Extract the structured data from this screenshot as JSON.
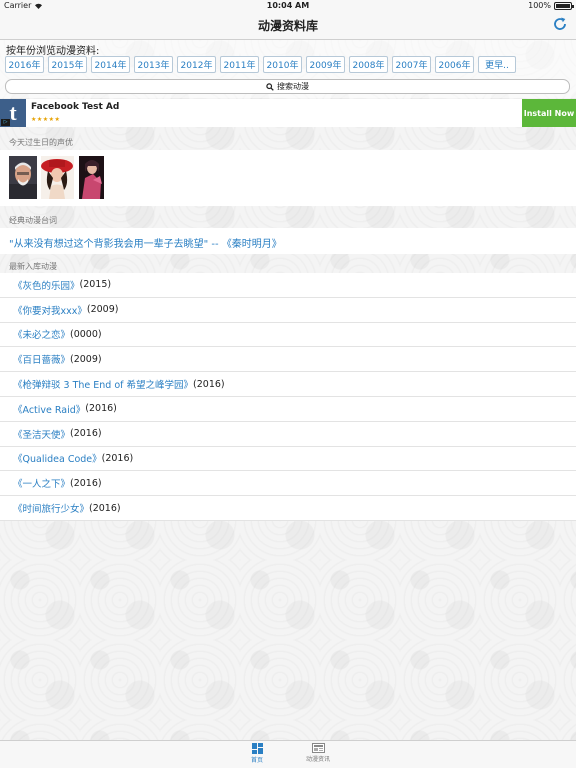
{
  "status_bar": {
    "carrier": "Carrier",
    "time": "10:04 AM",
    "battery": "100%",
    "battery_level": 1.0
  },
  "nav": {
    "title": "动漫资料库",
    "refresh_icon": "refresh-icon"
  },
  "year_browse": {
    "label": "按年份浏览动漫资料:",
    "years": [
      "2016年",
      "2015年",
      "2014年",
      "2013年",
      "2012年",
      "2011年",
      "2010年",
      "2009年",
      "2008年",
      "2007年",
      "2006年"
    ],
    "more": "更早..",
    "search_label": "搜索动漫",
    "search_icon": "search-icon"
  },
  "ad": {
    "logo_letter": "t",
    "corner_mark": "▷",
    "title": "Facebook Test Ad",
    "stars": "★★★★★",
    "install": "Install Now",
    "install_color": "#5cb73a"
  },
  "birthday": {
    "header": "今天过生日的声优"
  },
  "quote": {
    "header": "经典动漫台词",
    "text": "\"从来没有想过这个背影我会用一辈子去眺望\"   --  《秦时明月》"
  },
  "latest": {
    "header": "最新入库动漫",
    "items": [
      {
        "title": "《灰色的乐园》",
        "year": "(2015)"
      },
      {
        "title": "《你要对我xxx》",
        "year": "(2009)"
      },
      {
        "title": "《未必之恋》",
        "year": "(0000)"
      },
      {
        "title": "《百日蔷薇》",
        "year": "(2009)"
      },
      {
        "title": "《枪弹辩驳 3 The End of 希望之峰学园》",
        "year": "(2016)"
      },
      {
        "title": "《Active Raid》",
        "year": "(2016)"
      },
      {
        "title": "《圣洁天使》",
        "year": "(2016)"
      },
      {
        "title": "《Qualidea Code》",
        "year": "(2016)"
      },
      {
        "title": "《一人之下》",
        "year": "(2016)"
      },
      {
        "title": "《时间旅行少女》",
        "year": "(2016)"
      }
    ]
  },
  "tabs": {
    "home": {
      "label": "首页",
      "icon": "grid-icon"
    },
    "news": {
      "label": "动漫资讯",
      "icon": "newspaper-icon"
    }
  },
  "colors": {
    "link": "#2a7fc3",
    "install": "#5cb73a",
    "tab_active": "#2a7fc3"
  }
}
